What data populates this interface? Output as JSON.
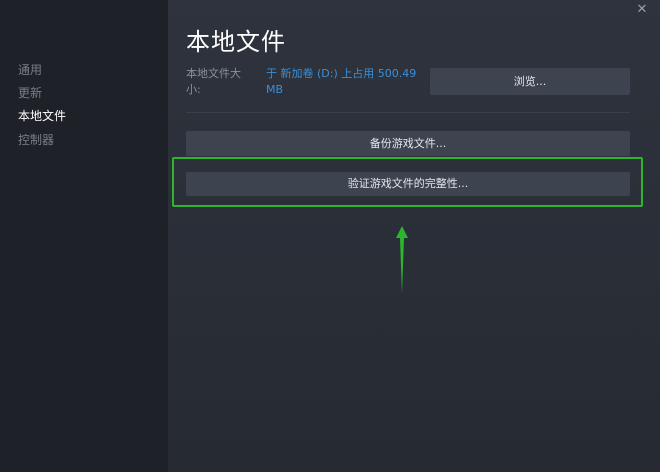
{
  "sidebar": {
    "items": [
      {
        "label": "通用",
        "active": false
      },
      {
        "label": "更新",
        "active": false
      },
      {
        "label": "本地文件",
        "active": true
      },
      {
        "label": "控制器",
        "active": false
      }
    ]
  },
  "window": {
    "close_icon": "close-icon",
    "close_glyph": "✕"
  },
  "main": {
    "title": "本地文件",
    "size_label": "本地文件大小:",
    "size_value": "于 新加卷 (D:) 上占用 500.49 MB",
    "browse_label": "浏览...",
    "backup_label": "备份游戏文件...",
    "verify_label": "验证游戏文件的完整性..."
  },
  "colors": {
    "accent": "#3b8fd9",
    "highlight": "#2db52d",
    "button": "#3d4450"
  }
}
